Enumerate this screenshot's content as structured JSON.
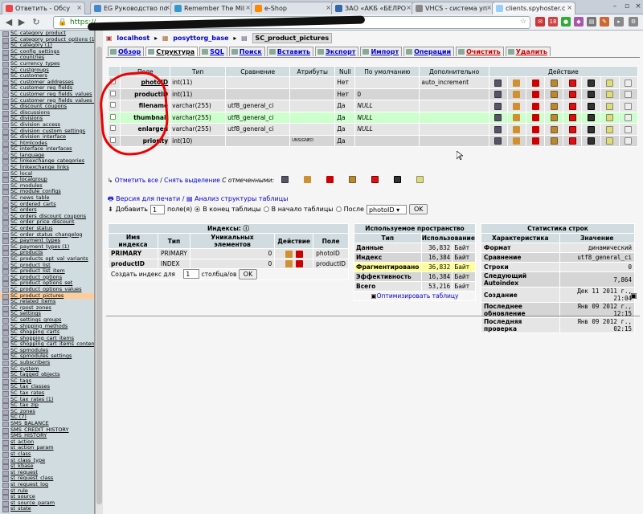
{
  "browser": {
    "tabs": [
      {
        "label": "Ответить - Обсу",
        "color": "#e44"
      },
      {
        "label": "EG Руководство по",
        "color": "#48c"
      },
      {
        "label": "Remember The Mil",
        "color": "#39c"
      },
      {
        "label": "e-Shop",
        "color": "#f80"
      },
      {
        "label": "ЗАО «АКБ «БЕЛРО",
        "color": "#36a"
      },
      {
        "label": "VHCS - система уп",
        "color": "#888"
      },
      {
        "label": "clients.spyhoster.c",
        "color": "#9cf"
      }
    ],
    "url_prefix": "https://"
  },
  "sidebar": {
    "items": [
      "SC_category_product",
      "SC_category_product_options (1)",
      "SC_category (1)",
      "SC_config_settings",
      "SC_countries",
      "SC_currency_types",
      "SC_custgroups",
      "SC_customers",
      "SC_customer_addresses",
      "SC_customer_reg_fields",
      "SC_customer_reg_fields_values",
      "SC_customer_reg_fields_values_quickreg",
      "SC_discount_coupons",
      "SC_discussions",
      "SC_divisions",
      "SC_division_access",
      "SC_division_custom_settings",
      "SC_division_interface",
      "SC_htmlcodes",
      "SC_interface_interfaces",
      "SC_language",
      "SC_linkexchange_categories",
      "SC_linkexchange_links",
      "SC_local",
      "SC_localgroup",
      "SC_modules",
      "SC_module_configs",
      "SC_news_table",
      "SC_ordered_carts",
      "SC_orders",
      "SC_orders_discount_coupons",
      "SC_order_price_discount",
      "SC_order_status",
      "SC_order_status_changelog",
      "SC_payment_types",
      "SC_payment_types (1)",
      "SC_products",
      "SC_products_opt_val_variants",
      "SC_product_list",
      "SC_product_list_item",
      "SC_product_options",
      "SC_product_options_set",
      "SC_product_options_values",
      "SC_product_pictures",
      "SC_related_items",
      "SC_rpost_zones",
      "SC_settings",
      "SC_settings_groups",
      "SC_shipping_methods",
      "SC_shopping_carts",
      "SC_shopping_cart_items",
      "SC_shopping_cart_items_content",
      "SC_spmodules",
      "SC_spmodules_settings",
      "SC_subscribers",
      "SC_system",
      "SC_tagged_objects",
      "SC_tags",
      "SC_tax_classes",
      "SC_tax_rates",
      "SC_tax_rates (1)",
      "SC_tax_zip",
      "SC_zones",
      "SC (7)",
      "SMS_BALANCE",
      "SMS_CREDIT_HISTORY",
      "SMS_HISTORY",
      "st_action",
      "st_action_param",
      "st_class",
      "st_class_type",
      "st_kbase",
      "st_request",
      "st_request_class",
      "st_request_log",
      "st_rule",
      "st_source",
      "st_source_param",
      "st_state"
    ],
    "selected": "SC_product_pictures"
  },
  "breadcrumb": {
    "server": "localhost",
    "db": "posyttorg_base",
    "table": "SC_product_pictures"
  },
  "menu": [
    "Обзор",
    "Структура",
    "SQL",
    "Поиск",
    "Вставить",
    "Экспорт",
    "Импорт",
    "Операции",
    "Очистить",
    "Удалить"
  ],
  "structure": {
    "headers": [
      "Поле",
      "Тип",
      "Сравнение",
      "Атрибуты",
      "Null",
      "По умолчанию",
      "Дополнительно",
      "Действие"
    ],
    "rows": [
      {
        "field": "photoID",
        "type": "int(11)",
        "collation": "",
        "attrs": "",
        "null": "Нет",
        "default": "",
        "extra": "auto_increment",
        "style": "o",
        "u": true
      },
      {
        "field": "productID",
        "type": "int(11)",
        "collation": "",
        "attrs": "",
        "null": "Нет",
        "default": "0",
        "extra": "",
        "style": "e",
        "u": false
      },
      {
        "field": "filename",
        "type": "varchar(255)",
        "collation": "utf8_general_ci",
        "attrs": "",
        "null": "Да",
        "default": "NULL",
        "extra": "",
        "style": "o",
        "u": false
      },
      {
        "field": "thumbnail",
        "type": "varchar(255)",
        "collation": "utf8_general_ci",
        "attrs": "",
        "null": "Да",
        "default": "NULL",
        "extra": "",
        "style": "h",
        "u": false
      },
      {
        "field": "enlarged",
        "type": "varchar(255)",
        "collation": "utf8_general_ci",
        "attrs": "",
        "null": "Да",
        "default": "NULL",
        "extra": "",
        "style": "o",
        "u": false
      },
      {
        "field": "priority",
        "type": "int(10)",
        "collation": "",
        "attrs": "UNSIGNED",
        "null": "Да",
        "default": "",
        "extra": "",
        "style": "e",
        "u": false
      }
    ],
    "footer": {
      "check_all": "Отметить все",
      "sep": " / ",
      "uncheck": "Снять выделение",
      "with_selected": "С отмеченными:"
    }
  },
  "print_link": "Версия для печати",
  "analyze_link": "Анализ структуры таблицы",
  "add": {
    "label": "Добавить",
    "count": "1",
    "fields": "поле(я)",
    "end": "В конец таблицы",
    "start": "В начало таблицы",
    "after": "После",
    "after_field": "photoID",
    "ok": "OK"
  },
  "indexes": {
    "title": "Индексы:",
    "headers": [
      "Имя индекса",
      "Тип",
      "Уникальных элементов",
      "Действие",
      "Поле"
    ],
    "rows": [
      {
        "name": "PRIMARY",
        "type": "PRIMARY",
        "card": "0",
        "field": "photoID"
      },
      {
        "name": "productID",
        "type": "INDEX",
        "card": "0",
        "field": "productID"
      }
    ],
    "create_label": "Создать индекс для",
    "create_count": "1",
    "create_suffix": "столбца/ов",
    "ok": "OK"
  },
  "space": {
    "title": "Используемое пространство",
    "headers": [
      "Тип",
      "Использование"
    ],
    "rows": [
      {
        "k": "Данные",
        "v": "36,832",
        "u": "Байт"
      },
      {
        "k": "Индекс",
        "v": "16,384",
        "u": "Байт"
      },
      {
        "k": "Фрагментировано",
        "v": "36,832",
        "u": "Байт"
      },
      {
        "k": "Эффективность",
        "v": "16,384",
        "u": "Байт"
      },
      {
        "k": "Всего",
        "v": "53,216",
        "u": "Байт"
      }
    ],
    "optimize": "Оптимизировать таблицу"
  },
  "rowstats": {
    "title": "Статистика строк",
    "headers": [
      "Характеристика",
      "Значение"
    ],
    "rows": [
      {
        "k": "Формат",
        "v": "динамический"
      },
      {
        "k": "Сравнение",
        "v": "utf8_general_ci"
      },
      {
        "k": "Строки",
        "v": "0"
      },
      {
        "k": "Следующий Autoindex",
        "v": "7,864"
      },
      {
        "k": "Создание",
        "v": "Дек 11 2011 г., 21:04"
      },
      {
        "k": "Последнее обновление",
        "v": "Янв 09 2012 г., 12:15"
      },
      {
        "k": "Последняя проверка",
        "v": "Янв 09 2012 г., 02:15"
      }
    ]
  }
}
